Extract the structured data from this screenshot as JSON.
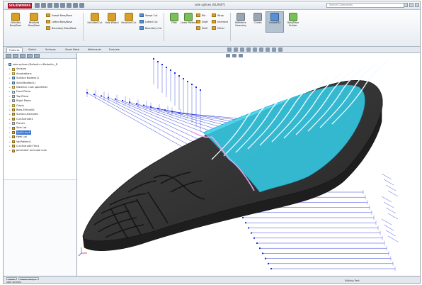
{
  "titlebar": {
    "logo": "SOLIDWORKS",
    "document_title": "sole splines (GLASS*)",
    "search_placeholder": "Search Commands"
  },
  "ribbon": {
    "large_buttons": [
      {
        "label": "Extruded Boss/Base",
        "icon": "extruded-boss-icon"
      },
      {
        "label": "Revolved Boss/Base",
        "icon": "revolved-boss-icon"
      },
      {
        "label": "Extruded Cut",
        "icon": "extruded-cut-icon"
      },
      {
        "label": "Hole Wizard",
        "icon": "hole-wizard-icon"
      },
      {
        "label": "Revolved Cut",
        "icon": "revolved-cut-icon"
      },
      {
        "label": "Fillet",
        "icon": "fillet-icon"
      },
      {
        "label": "Linear Pattern",
        "icon": "linear-pattern-icon"
      },
      {
        "label": "Reference Geometry",
        "icon": "reference-geometry-icon"
      },
      {
        "label": "Curves",
        "icon": "curves-icon"
      },
      {
        "label": "Instant3D",
        "icon": "instant3d-icon"
      },
      {
        "label": "Boss/Base Builder",
        "icon": "builder-icon"
      }
    ],
    "small_group_1": [
      "Swept Boss/Base",
      "Lofted Boss/Base",
      "Boundary Boss/Base"
    ],
    "small_group_2": [
      "Swept Cut",
      "Lofted Cut",
      "Boundary Cut"
    ],
    "small_group_3": [
      "Rib",
      "Draft",
      "Shell"
    ],
    "small_group_4": [
      "Wrap",
      "Intersect",
      "Mirror"
    ]
  },
  "cm_tabs": [
    "Features",
    "Sketch",
    "Surfaces",
    "Sheet Metal",
    "Weldments",
    "Evaluate"
  ],
  "feature_tree": {
    "root": "sole splines (Default<<Default>_D",
    "items": [
      {
        "label": "Sensors",
        "icon": "sensors-icon",
        "kind": "ann",
        "indent": 1
      },
      {
        "label": "Annotations",
        "icon": "annotations-icon",
        "kind": "ann",
        "indent": 1
      },
      {
        "label": "Surface Bodies(1)",
        "icon": "surface-bodies-icon",
        "kind": "body",
        "indent": 1
      },
      {
        "label": "Solid Bodies(1)",
        "icon": "solid-bodies-icon",
        "kind": "body",
        "indent": 1
      },
      {
        "label": "Material <not specified>",
        "icon": "material-icon",
        "kind": "ann",
        "indent": 1
      },
      {
        "label": "Front Plane",
        "icon": "plane-icon",
        "kind": "plane",
        "indent": 1
      },
      {
        "label": "Top Plane",
        "icon": "plane-icon",
        "kind": "plane",
        "indent": 1
      },
      {
        "label": "Right Plane",
        "icon": "plane-icon",
        "kind": "plane",
        "indent": 1
      },
      {
        "label": "Origin",
        "icon": "origin-icon",
        "kind": "ann",
        "indent": 1
      },
      {
        "label": "Boss-Extrude1",
        "icon": "boss-extrude-icon",
        "kind": "feat",
        "indent": 1
      },
      {
        "label": "Surface-Extrude1",
        "icon": "surface-extrude-icon",
        "kind": "feat",
        "indent": 1
      },
      {
        "label": "Cut-Extrude1",
        "icon": "cut-extrude-icon",
        "kind": "feat",
        "indent": 1
      },
      {
        "label": "Plane1",
        "icon": "plane-icon",
        "kind": "plane",
        "indent": 1
      },
      {
        "label": "Sole Lat",
        "icon": "sketch-icon",
        "kind": "feat",
        "indent": 1
      },
      {
        "label": "Split Line1",
        "icon": "split-line-icon",
        "kind": "feat",
        "indent": 1,
        "selected": true
      },
      {
        "label": "Heel Lat",
        "icon": "sketch-icon",
        "kind": "feat",
        "indent": 1
      },
      {
        "label": "VarPattern1",
        "icon": "var-pattern-icon",
        "kind": "feat",
        "indent": 1
      },
      {
        "label": "Cut-Extrude-Thin1",
        "icon": "cut-extrude-icon",
        "kind": "feat",
        "indent": 1
      },
      {
        "label": "perimeter and seal cuts",
        "icon": "folder-icon",
        "kind": "feat",
        "indent": 1
      }
    ]
  },
  "status": {
    "left_text": "sole splines",
    "right_text": "Editing Part",
    "model_tabs": [
      "Model",
      "Motion Study 1"
    ]
  },
  "colors": {
    "sole_body": "#3a3a3a",
    "sole_top": "#2b2b2b",
    "highlight": "#38d6f0",
    "dimension": "#1e2fd6",
    "split_line": "#e9a6e6"
  }
}
